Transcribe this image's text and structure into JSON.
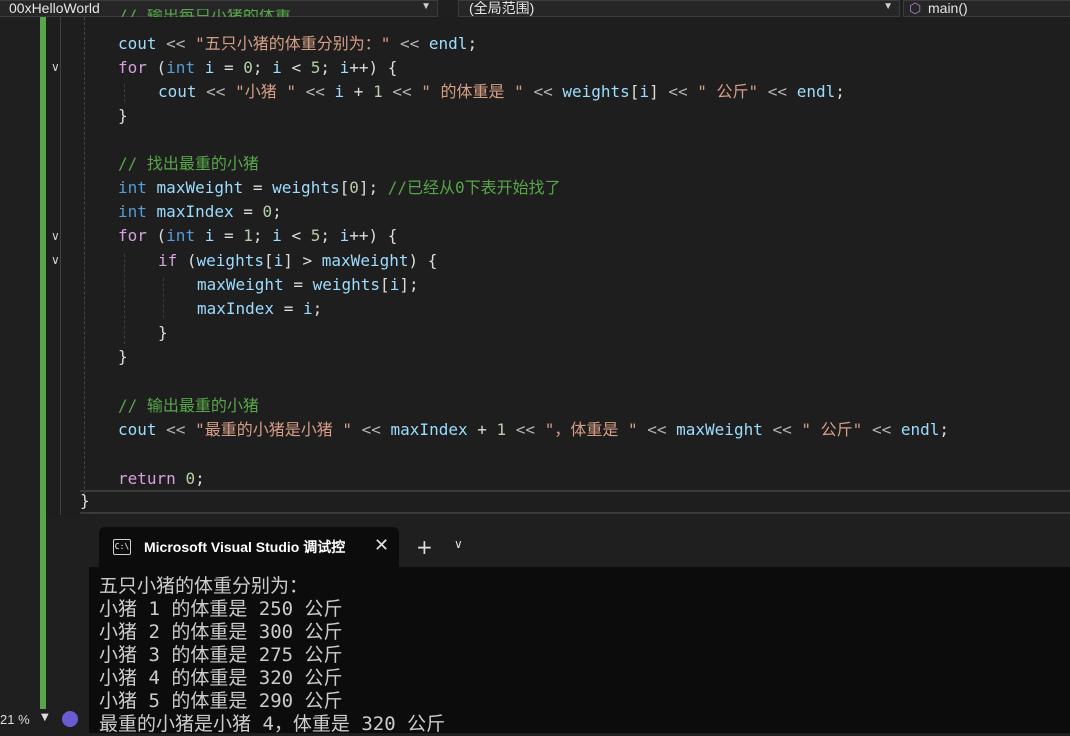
{
  "toolbar": {
    "project": "00xHelloWorld",
    "scope": "(全局范围)",
    "member": "main()"
  },
  "code": {
    "partial_comment": "// 输出每只小猪的体重",
    "lines": [
      "cout << \"五只小猪的体重分别为：\" << endl;",
      "for (int i = 0; i < 5; i++) {",
      "cout << \"小猪 \" << i + 1 << \" 的体重是 \" << weights[i] << \" 公斤\" << endl;",
      "}",
      "",
      "// 找出最重的小猪",
      "int maxWeight = weights[0]; //已经从0下表开始找了",
      "int maxIndex = 0;",
      "for (int i = 1; i < 5; i++) {",
      "if (weights[i] > maxWeight) {",
      "maxWeight = weights[i];",
      "maxIndex = i;",
      "}",
      "}",
      "",
      "// 输出最重的小猪",
      "cout << \"最重的小猪是小猪 \" << maxIndex + 1 << \"，体重是 \" << maxWeight << \" 公斤\" << endl;",
      "",
      "return 0;",
      "}"
    ]
  },
  "terminal": {
    "tab_title": "Microsoft Visual Studio 调试控",
    "tab_icon_text": "C:\\",
    "close": "✕",
    "new_tab": "+",
    "dropdown": "⌄",
    "output": [
      "五只小猪的体重分别为：",
      "小猪 1 的体重是 250 公斤",
      "小猪 2 的体重是 300 公斤",
      "小猪 3 的体重是 275 公斤",
      "小猪 4 的体重是 320 公斤",
      "小猪 5 的体重是 290 公斤",
      "最重的小猪是小猪 4，体重是 320 公斤"
    ]
  },
  "status": {
    "zoom": "21 %"
  },
  "colors": {
    "keyword": "#569cd6",
    "string": "#d69d85",
    "comment": "#57a64a",
    "identifier": "#9cdcfe",
    "change_bar": "#57a64a"
  }
}
